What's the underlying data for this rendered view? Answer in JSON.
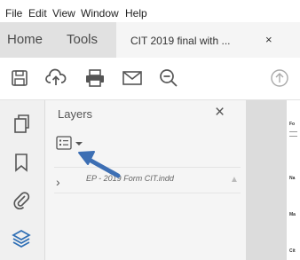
{
  "menu": {
    "file": "File",
    "edit": "Edit",
    "view": "View",
    "window": "Window",
    "help": "Help"
  },
  "tabs": {
    "home": "Home",
    "tools": "Tools",
    "document": "CIT 2019 final with ...",
    "document_close": "×"
  },
  "toolbar": {
    "icons": [
      "save-icon",
      "upload-cloud-icon",
      "print-icon",
      "email-icon",
      "zoom-out-icon",
      "page-up-icon"
    ]
  },
  "rail": {
    "icons": [
      "pages-icon",
      "bookmark-icon",
      "attachment-icon",
      "layers-icon"
    ]
  },
  "panel": {
    "title": "Layers",
    "close": "×",
    "layer_name": "EP - 2019 Form CIT.indd",
    "chevron": "›"
  },
  "document": {
    "labels": [
      "Fo",
      "Na",
      "Ma",
      "Cit"
    ]
  },
  "colors": {
    "accent_blue": "#2f6fb5",
    "arrow_blue": "#3d6fb4",
    "tab_bar": "#e1e1e1",
    "panel_bg": "#f5f5f5"
  }
}
